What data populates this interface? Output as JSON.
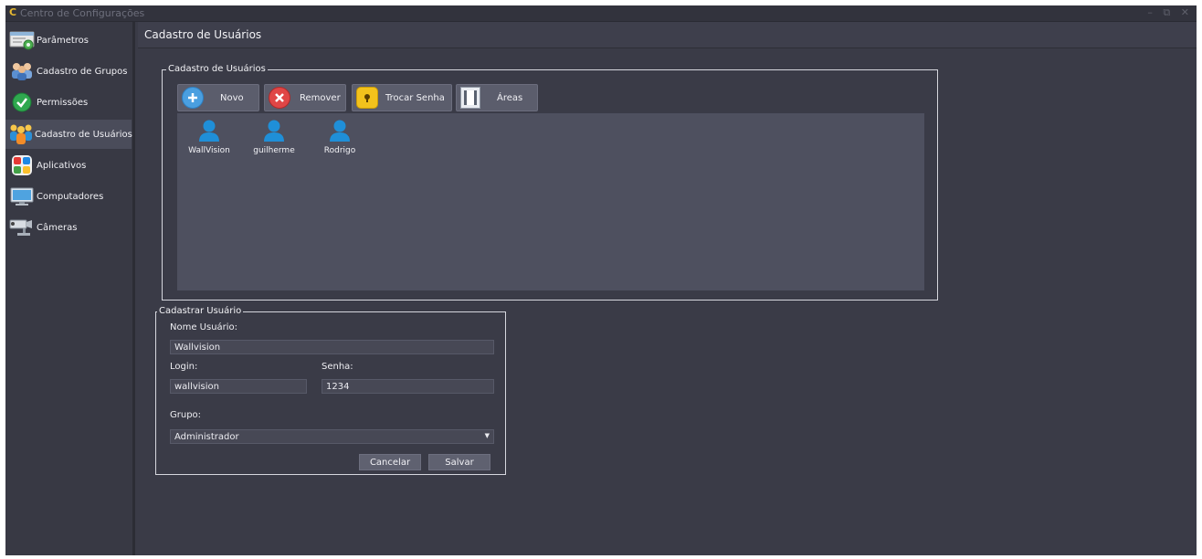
{
  "window": {
    "logo": "C",
    "title": "Centro de Configurações",
    "controls": [
      "–",
      "⧉",
      "✕"
    ]
  },
  "sidebar": {
    "items": [
      {
        "label": "Parâmetros",
        "icon": "parameters-icon"
      },
      {
        "label": "Cadastro de Grupos",
        "icon": "groups-icon"
      },
      {
        "label": "Permissões",
        "icon": "permissions-check-icon"
      },
      {
        "label": "Cadastro de Usuários",
        "icon": "users-icon",
        "active": true
      },
      {
        "label": "Aplicativos",
        "icon": "apps-icon"
      },
      {
        "label": "Computadores",
        "icon": "monitor-icon"
      },
      {
        "label": "Câmeras",
        "icon": "camera-icon"
      }
    ]
  },
  "main": {
    "title": "Cadastro de Usuários"
  },
  "users_panel": {
    "legend": "Cadastro de Usuários",
    "toolbar": {
      "new_label": "Novo",
      "remove_label": "Remover",
      "change_password_label": "Trocar Senha",
      "areas_label": "Áreas"
    },
    "users": [
      "WallVision",
      "guilherme",
      "Rodrigo"
    ]
  },
  "form": {
    "legend": "Cadastrar Usuário",
    "name_label": "Nome Usuário:",
    "name_value": "Wallvision",
    "login_label": "Login:",
    "login_value": "wallvision",
    "password_label": "Senha:",
    "password_value": "1234",
    "group_label": "Grupo:",
    "group_value": "Administrador",
    "cancel_label": "Cancelar",
    "save_label": "Salvar"
  },
  "colors": {
    "background": "#3a3b47",
    "panel": "#4e505f",
    "accent_user": "#1f8fd8",
    "border": "#d6d7de"
  }
}
